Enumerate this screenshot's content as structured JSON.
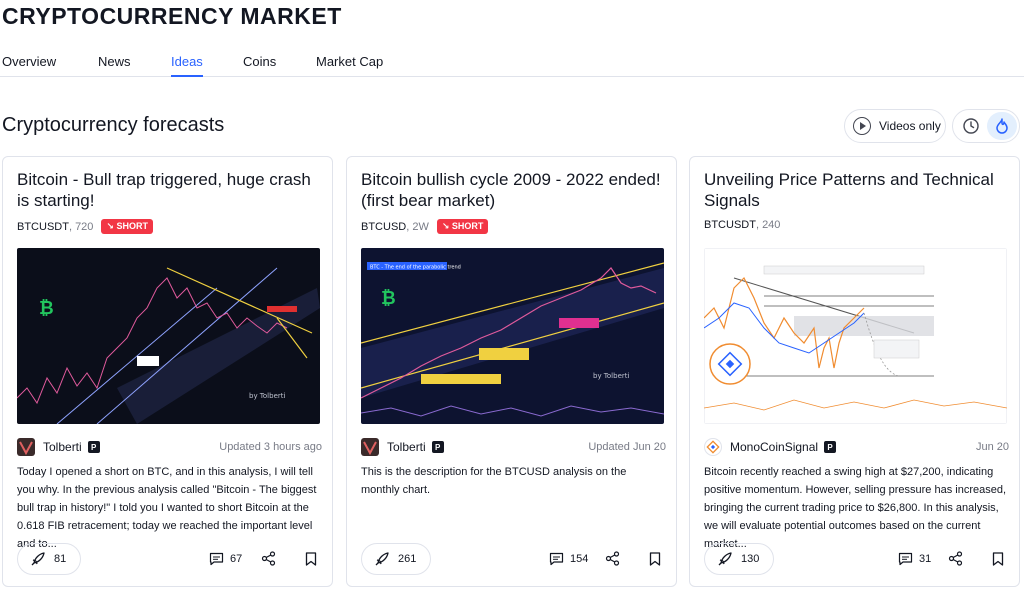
{
  "header": {
    "title": "CRYPTOCURRENCY MARKET"
  },
  "tabs": [
    {
      "label": "Overview",
      "active": false
    },
    {
      "label": "News",
      "active": false
    },
    {
      "label": "Ideas",
      "active": true
    },
    {
      "label": "Coins",
      "active": false
    },
    {
      "label": "Market Cap",
      "active": false
    }
  ],
  "section": {
    "title": "Cryptocurrency forecasts",
    "videos_only_label": "Videos only",
    "sort_icons": [
      "clock-icon",
      "flame-icon"
    ]
  },
  "colors": {
    "accent": "#2962ff",
    "short": "#f23645",
    "border": "#e0e3eb",
    "muted": "#787b86"
  },
  "cards": [
    {
      "title": "Bitcoin - Bull trap triggered, huge crash is starting!",
      "symbol": "BTCUSDT",
      "timeframe": ", 720",
      "badge": "SHORT",
      "author": "Tolberti",
      "pro": "P",
      "updated": "Updated 3 hours ago",
      "description": "Today I opened a short on BTC, and in this analysis, I will tell you why. In the previous analysis called \"Bitcoin - The biggest bull trap in history!\" I told you I wanted to short Bitcoin at the 0.618 FIB retracement; today we reached the important level and to...",
      "boosts": "81",
      "comments": "67",
      "chart_watermark": "by Tolberti"
    },
    {
      "title": "Bitcoin bullish cycle 2009 - 2022 ended! (first bear market)",
      "symbol": "BTCUSD",
      "timeframe": ", 2W",
      "badge": "SHORT",
      "author": "Tolberti",
      "pro": "P",
      "updated": "Updated Jun 20",
      "description": "This is the description for the BTCUSD analysis on the monthly chart.",
      "boosts": "261",
      "comments": "154",
      "chart_watermark": "by Tolberti",
      "chart_caption": "BTC - The end of the parabolic trend"
    },
    {
      "title": "Unveiling Price Patterns and Technical Signals",
      "symbol": "BTCUSDT",
      "timeframe": ", 240",
      "badge": "",
      "author": "MonoCoinSignal",
      "pro": "P",
      "updated": "Jun 20",
      "description": "Bitcoin recently reached a swing high at $27,200, indicating positive momentum. However, selling pressure has increased, bringing the current trading price to $26,800. In this analysis, we will evaluate potential outcomes based on the current market...",
      "boosts": "130",
      "comments": "31"
    }
  ]
}
